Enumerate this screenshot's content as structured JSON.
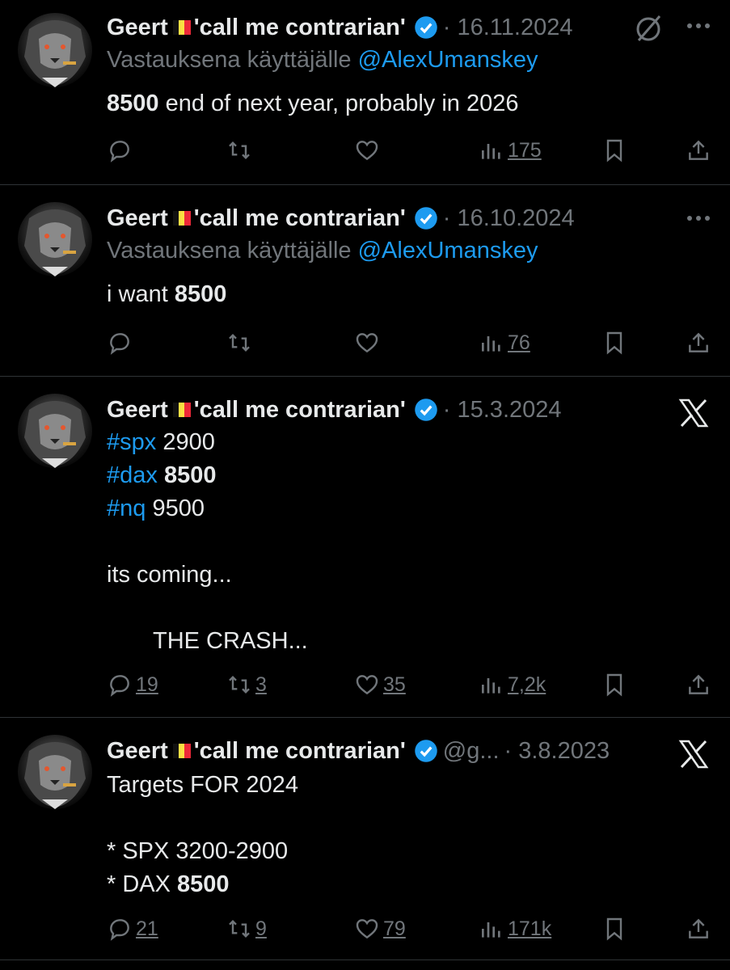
{
  "colors": {
    "background": "#000000",
    "text": "#e7e9ea",
    "muted": "#71767b",
    "link": "#1d9bf0",
    "verified": "#1d9bf0",
    "divider": "#2f3336"
  },
  "tweets": [
    {
      "name": "Geert",
      "name_suffix": "'call me contrarian'",
      "date": "· 16.11.2024",
      "reply_prefix": "Vastauksena käyttäjälle",
      "reply_mention": "@AlexUmanskey",
      "line1_bold": "8500",
      "line1_rest": " end of next year, probably in 2026",
      "stats": {
        "reply": "",
        "retweet": "",
        "like": "",
        "views": "175"
      },
      "top_icon": "grok-slash-icon"
    },
    {
      "name": "Geert",
      "name_suffix": "'call me contrarian'",
      "date": "· 16.10.2024",
      "reply_prefix": "Vastauksena käyttäjälle",
      "reply_mention": "@AlexUmanskey",
      "line1_pre": "i want ",
      "line1_bold": "8500",
      "stats": {
        "reply": "",
        "retweet": "",
        "like": "",
        "views": "76"
      }
    },
    {
      "name": "Geert",
      "name_suffix": "'call me contrarian'",
      "date": "· 15.3.2024",
      "lines": [
        {
          "tag": "#spx",
          "value": " 2900"
        },
        {
          "tag": "#dax",
          "value_bold": " 8500"
        },
        {
          "tag": "#nq",
          "value": " 9500"
        }
      ],
      "coming": "its coming...",
      "crash": "THE CRASH...",
      "stats": {
        "reply": "19",
        "retweet": "3",
        "like": "35",
        "views": "7,2k"
      },
      "top_icon": "x-logo-icon"
    },
    {
      "name": "Geert",
      "name_suffix": "'call me contrarian'",
      "handle": "@g...",
      "date": "· 3.8.2023",
      "title": "Targets FOR 2024",
      "spx": "* SPX 3200-2900",
      "dax_pre": "* DAX ",
      "dax_bold": "8500",
      "stats": {
        "reply": "21",
        "retweet": "9",
        "like": "79",
        "views": "171k"
      },
      "top_icon": "x-logo-icon"
    }
  ]
}
